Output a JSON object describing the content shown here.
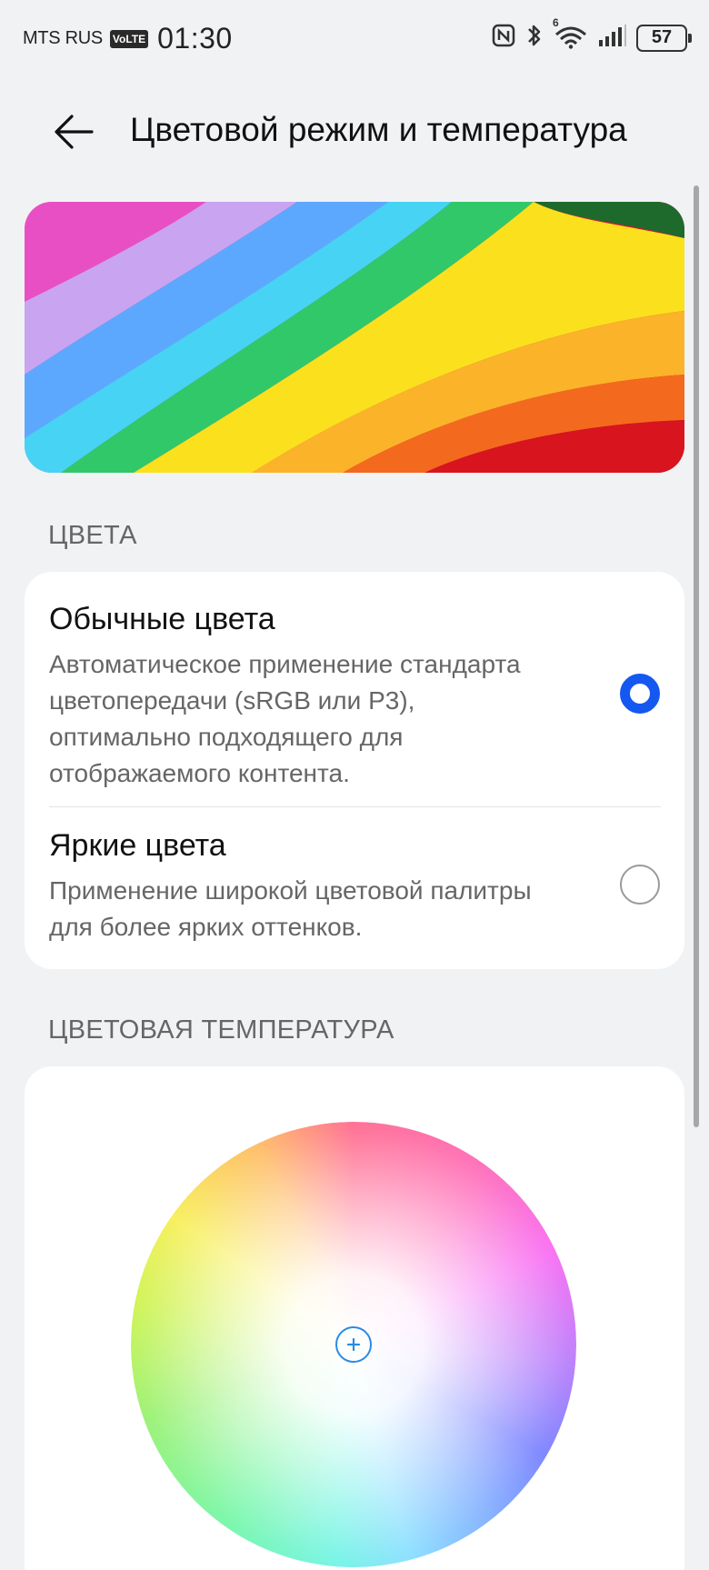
{
  "status_bar": {
    "carrier": "MTS RUS",
    "volte": "VoLTE",
    "time": "01:30",
    "network": "6",
    "battery": "57"
  },
  "header": {
    "title": "Цветовой режим и температура"
  },
  "colors_section": {
    "label": "ЦВЕТА",
    "options": [
      {
        "title": "Обычные цвета",
        "description": "Автоматическое применение стандарта цветопередачи (sRGB или P3), оптимально подходящего для отображаемого контента.",
        "selected": true
      },
      {
        "title": "Яркие цвета",
        "description": "Применение широкой цветовой палитры для более ярких оттенков.",
        "selected": false
      }
    ]
  },
  "temperature_section": {
    "label": "ЦВЕТОВАЯ ТЕМПЕРАТУРА"
  },
  "accent_color": "#1558f0",
  "marker_color": "#2a8ae6"
}
